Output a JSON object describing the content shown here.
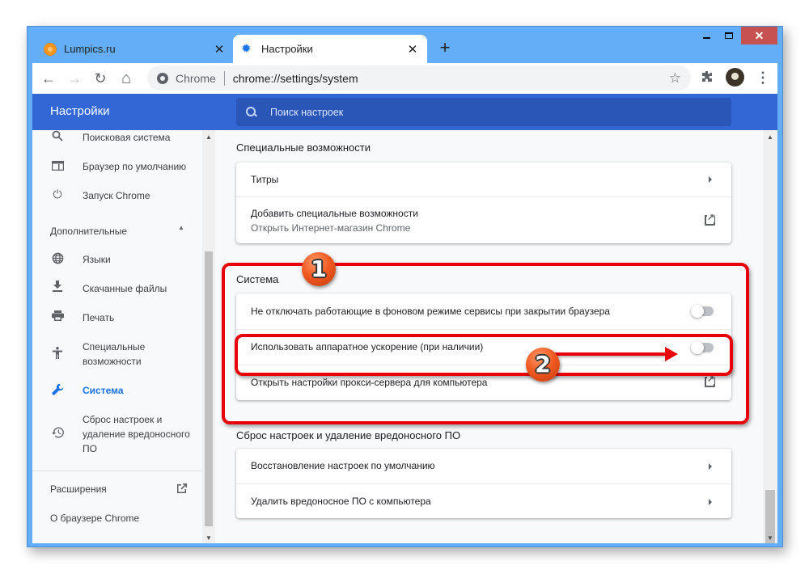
{
  "window": {
    "tabs": [
      {
        "title": "Lumpics.ru",
        "favicon": "orange-icon",
        "active": false
      },
      {
        "title": "Настройки",
        "favicon": "gear-icon",
        "active": true
      }
    ],
    "new_tab_label": "+",
    "controls": {
      "minimize": "—",
      "maximize": "☐",
      "close": "✕"
    }
  },
  "toolbar": {
    "back": "←",
    "forward": "→",
    "reload": "↻",
    "home": "⌂",
    "omnibox": {
      "chip": "Chrome",
      "url": "chrome://settings/system"
    },
    "star": "☆",
    "extensions": "puzzle-icon",
    "menu": "⋮"
  },
  "header": {
    "title": "Настройки",
    "search_placeholder": "Поиск настроек"
  },
  "sidebar": {
    "items": [
      {
        "label": "Поисковая система",
        "icon": "⚲"
      },
      {
        "label": "Браузер по умолчанию",
        "icon": "▭"
      },
      {
        "label": "Запуск Chrome",
        "icon": "⏻"
      }
    ],
    "advanced_label": "Дополнительные",
    "advanced_items": [
      {
        "label": "Языки",
        "icon": "🌐"
      },
      {
        "label": "Скачанные файлы",
        "icon": "⬇"
      },
      {
        "label": "Печать",
        "icon": "⎙"
      },
      {
        "label": "Специальные возможности",
        "icon": "♿"
      },
      {
        "label": "Система",
        "icon": "🔧",
        "active": true
      },
      {
        "label": "Сброс настроек и удаление вредоносного ПО",
        "icon": "⟲"
      }
    ],
    "extensions_label": "Расширения",
    "about_label": "О браузере Chrome"
  },
  "main": {
    "accessibility": {
      "title": "Специальные возможности",
      "rows": [
        {
          "label": "Титры"
        },
        {
          "label": "Добавить специальные возможности",
          "sublabel": "Открыть Интернет-магазин Chrome"
        }
      ]
    },
    "system": {
      "title": "Система",
      "rows": [
        {
          "label": "Не отключать работающие в фоновом режиме сервисы при закрытии браузера",
          "toggle": false
        },
        {
          "label": "Использовать аппаратное ускорение (при наличии)",
          "toggle": false
        },
        {
          "label": "Открыть настройки прокси-сервера для компьютера"
        }
      ]
    },
    "reset": {
      "title": "Сброс настроек и удаление вредоносного ПО",
      "rows": [
        {
          "label": "Восстановление настроек по умолчанию"
        },
        {
          "label": "Удалить вредоносное ПО с компьютера"
        }
      ]
    }
  },
  "annotations": {
    "badge1": "1",
    "badge2": "2",
    "color": "#e8000b"
  }
}
